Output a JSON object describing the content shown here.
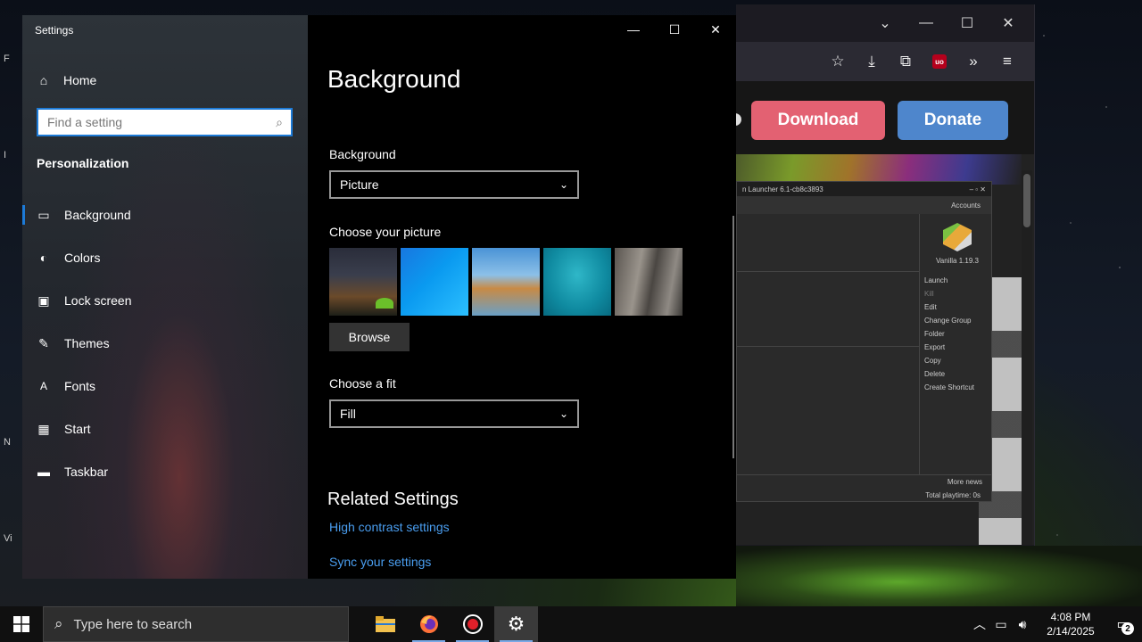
{
  "settings": {
    "app_title": "Settings",
    "home_label": "Home",
    "search_placeholder": "Find a setting",
    "section": "Personalization",
    "nav": [
      {
        "label": "Background",
        "icon": "picture-icon"
      },
      {
        "label": "Colors",
        "icon": "palette-icon"
      },
      {
        "label": "Lock screen",
        "icon": "lock-screen-icon"
      },
      {
        "label": "Themes",
        "icon": "brush-icon"
      },
      {
        "label": "Fonts",
        "icon": "fonts-icon"
      },
      {
        "label": "Start",
        "icon": "start-grid-icon"
      },
      {
        "label": "Taskbar",
        "icon": "taskbar-icon"
      }
    ],
    "active_nav": "Background",
    "page_title": "Background",
    "background_label": "Background",
    "background_value": "Picture",
    "choose_picture_label": "Choose your picture",
    "browse_label": "Browse",
    "choose_fit_label": "Choose a fit",
    "fit_value": "Fill",
    "related_title": "Related Settings",
    "links": [
      "High contrast settings",
      "Sync your settings"
    ],
    "accent": "#1d7ad6",
    "link_color": "#4a9ef0"
  },
  "browser": {
    "download_label": "Download",
    "donate_label": "Donate",
    "download_color": "#e36172",
    "donate_color": "#4e86cc"
  },
  "launcher": {
    "title": "n Launcher 6.1-cb8c3893",
    "accounts": "Accounts",
    "instance_name": "Vanilla 1.19.3",
    "actions": [
      "Launch",
      "Kill",
      "Edit",
      "Change Group",
      "Folder",
      "Export",
      "Copy",
      "Delete",
      "Create Shortcut"
    ],
    "more_news": "More news",
    "playtime": "Total playtime: 0s"
  },
  "taskbar": {
    "search_placeholder": "Type here to search",
    "time": "4:08 PM",
    "date": "2/14/2025",
    "notification_count": "2"
  },
  "edge_text": [
    "F",
    "I",
    "N",
    "Vi"
  ]
}
